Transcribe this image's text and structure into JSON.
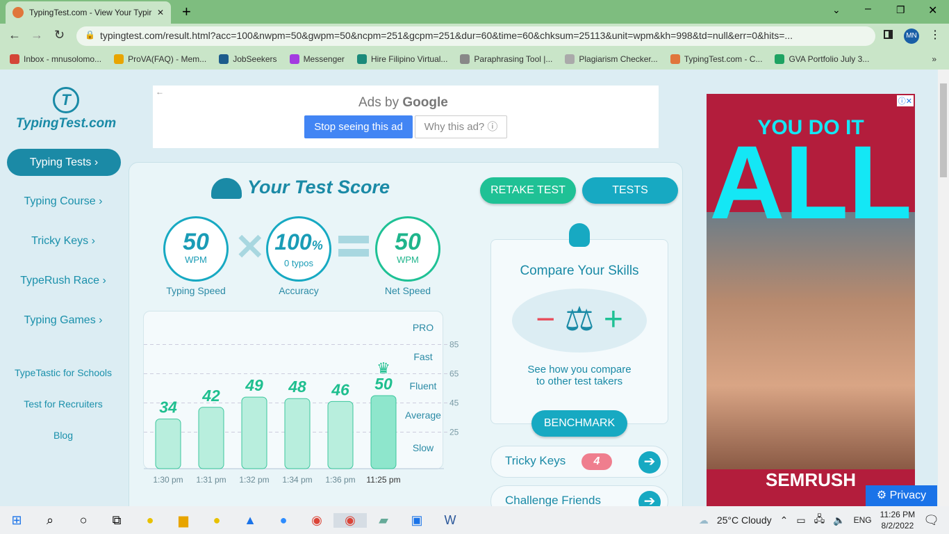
{
  "browser": {
    "tab_title": "TypingTest.com - View Your Typir",
    "url": "typingtest.com/result.html?acc=100&nwpm=50&gwpm=50&ncpm=251&gcpm=251&dur=60&time=60&chksum=25113&unit=wpm&kh=998&td=null&err=0&hits=...",
    "profile": "MN",
    "bookmarks": [
      "Inbox - mnusolomo...",
      "ProVA(FAQ) - Mem...",
      "JobSeekers",
      "Messenger",
      "Hire Filipino Virtual...",
      "Paraphrasing Tool |...",
      "Plagiarism Checker...",
      "TypingTest.com - C...",
      "GVA Portfolio July 3..."
    ],
    "bookmark_colors": [
      "#d44638",
      "#e8a500",
      "#1d5c8c",
      "#a33be0",
      "#1b8a7a",
      "#888",
      "#aaa",
      "#e0763b",
      "#1ea362"
    ]
  },
  "sidebar": {
    "logo": "TypingTest.com",
    "items": [
      "Typing Tests",
      "Typing Course",
      "Tricky Keys",
      "TypeRush Race",
      "Typing Games"
    ],
    "links": [
      "TypeTastic for Schools",
      "Test for Recruiters",
      "Blog"
    ]
  },
  "ad_top": {
    "ads_by": "Ads by",
    "google": "Google",
    "stop": "Stop seeing this ad",
    "why": "Why this ad? ⓘ"
  },
  "score": {
    "title": "Your Test Score",
    "speed": "50",
    "speed_unit": "WPM",
    "speed_label": "Typing Speed",
    "accuracy": "100",
    "accuracy_pct": "%",
    "typos": "0  typos",
    "accuracy_label": "Accuracy",
    "net": "50",
    "net_unit": "WPM",
    "net_label": "Net Speed"
  },
  "buttons": {
    "retake": "RETAKE TEST",
    "tests": "TESTS",
    "benchmark": "BENCHMARK"
  },
  "compare": {
    "title": "Compare Your Skills",
    "text1": "See how you compare",
    "text2": "to other test takers"
  },
  "pills": {
    "tricky": "Tricky Keys",
    "tricky_count": "4",
    "challenge": "Challenge Friends"
  },
  "chart_data": {
    "type": "bar",
    "categories": [
      "1:30 pm",
      "1:31 pm",
      "1:32 pm",
      "1:34 pm",
      "1:36 pm",
      "11:25 pm"
    ],
    "values": [
      34,
      42,
      49,
      48,
      46,
      50
    ],
    "highlight": "11:25 pm",
    "ylim": [
      0,
      100
    ],
    "gridlines": [
      25,
      45,
      65,
      85
    ],
    "levels": [
      "PRO",
      "Fast",
      "Fluent",
      "Average",
      "Slow"
    ]
  },
  "ad_right": {
    "headline": "YOU DO IT",
    "big": "ALL",
    "brand": "SEMRUSH",
    "privacy": "Privacy"
  },
  "taskbar": {
    "weather": "25°C  Cloudy",
    "lang": "ENG",
    "time": "11:26 PM",
    "date": "8/2/2022"
  }
}
